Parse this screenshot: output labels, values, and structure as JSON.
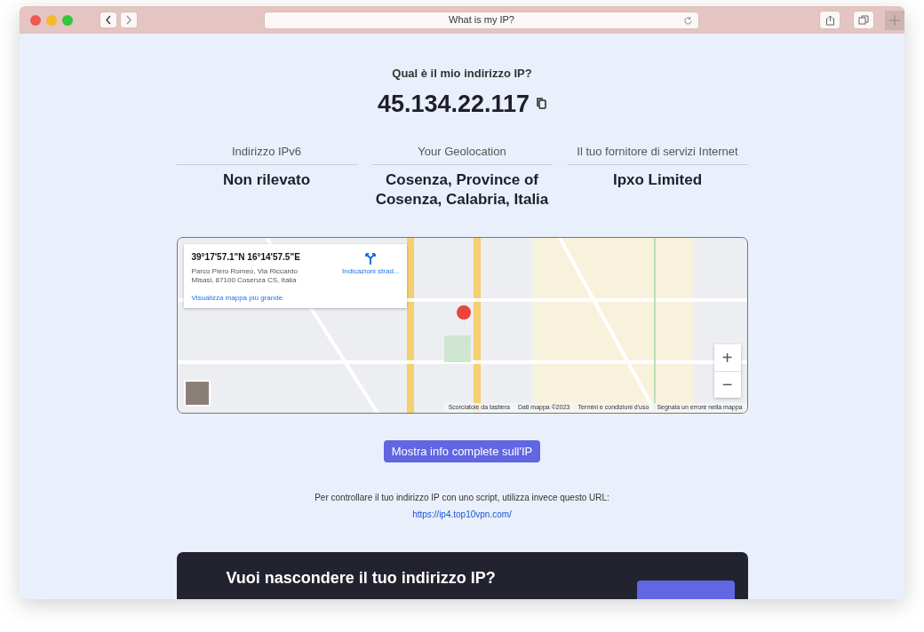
{
  "browser": {
    "address": "What is my IP?"
  },
  "page": {
    "question": "Qual è il mio indirizzo IP?",
    "ip": "45.134.22.117",
    "info": [
      {
        "label": "Indirizzo IPv6",
        "value": "Non rilevato"
      },
      {
        "label": "Your Geolocation",
        "value": "Cosenza, Province of Cosenza, Calabria, Italia"
      },
      {
        "label": "Il tuo fornitore di servizi Internet",
        "value": "Ipxo Limited"
      }
    ],
    "map": {
      "coordinates": "39°17'57.1\"N 16°14'57.5\"E",
      "address": "Parco Piero Romeo, Via Riccardo Misasi, 87100 Cosenza CS, Italia",
      "directions": "Indicazioni strad...",
      "larger_map": "Visualizza mappa più grande",
      "zoom_in": "+",
      "zoom_out": "−",
      "attribution": [
        "Scorciatoie da tastiera",
        "Dati mappa ©2023",
        "Termini e condizioni d'uso",
        "Segnala un errore nella mappa"
      ]
    },
    "button": "Mostra info complete sull'IP",
    "script_note": "Per controllare il tuo indirizzo IP con uno script, utilizza invece questo URL:",
    "script_url": "https://ip4.top10vpn.com/",
    "banner": {
      "title": "Vuoi nascondere il tuo indirizzo IP?"
    }
  }
}
